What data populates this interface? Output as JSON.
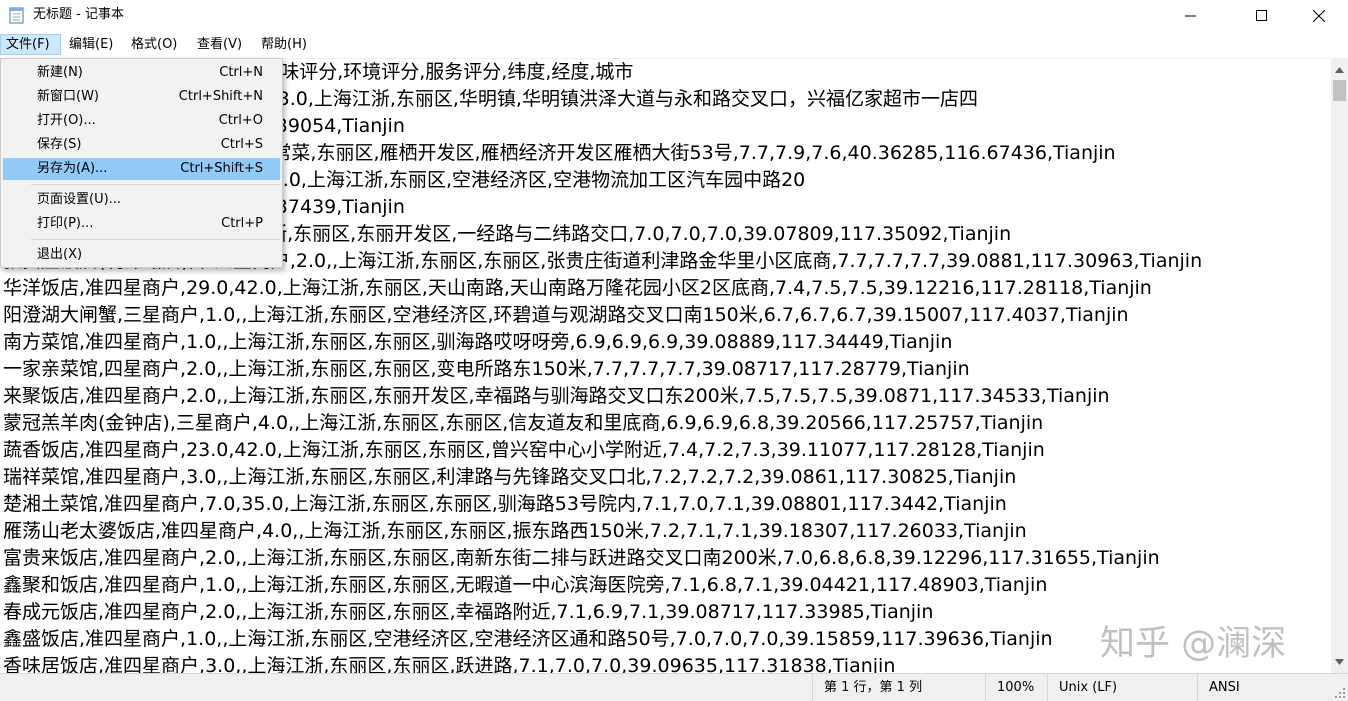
{
  "window": {
    "title": "无标题 - 记事本",
    "controls": {
      "minimize": "—",
      "maximize": "☐",
      "close": "✕"
    }
  },
  "menubar": {
    "items": [
      {
        "label": "文件(F)",
        "active": true
      },
      {
        "label": "编辑(E)"
      },
      {
        "label": "格式(O)"
      },
      {
        "label": "查看(V)"
      },
      {
        "label": "帮助(H)"
      }
    ]
  },
  "file_menu": {
    "items": [
      {
        "label": "新建(N)",
        "shortcut": "Ctrl+N"
      },
      {
        "label": "新窗口(W)",
        "shortcut": "Ctrl+Shift+N"
      },
      {
        "label": "打开(O)...",
        "shortcut": "Ctrl+O"
      },
      {
        "label": "保存(S)",
        "shortcut": "Ctrl+S"
      },
      {
        "label": "另存为(A)...",
        "shortcut": "Ctrl+Shift+S",
        "highlighted": true
      },
      {
        "label": "页面设置(U)...",
        "shortcut": ""
      },
      {
        "label": "打印(P)...",
        "shortcut": "Ctrl+P"
      },
      {
        "label": "退出(X)",
        "shortcut": ""
      }
    ]
  },
  "editor": {
    "lines": [
      "店名,店类型,行政区,商圈,地址,口味评分,环境评分,服务评分,纬度,经度,城市",
      "华明镇饭店,准四星商户,358.0,63.0,上海江浙,东丽区,华明镇,华明镇洪泽大道与永和路交叉口，兴福亿家超市一店四",
      "楼,7.2,7.2,7.2,39.14048,117.39054,Tianjin",
      "雁栖湖饭店,准四星商户,69.0,家常菜,东丽区,雁栖开发区,雁栖经济开发区雁栖大街53号,7.7,7.9,7.6,40.36285,116.67436,Tianjin",
      "空港饭店,准四星商户,109.0,131.0,上海江浙,东丽区,空港经济区,空港物流加工区汽车园中路20",
      "号,7.0,7.0,7.0,39.14582,117.37439,Tianjin",
      "一经路饭店,准四星商户,,上海江浙,东丽区,东丽开发区,一经路与二纬路交口,7.0,7.0,7.0,39.07809,117.35092,Tianjin",
      "张贵庄饭店(利津路店),准四星商户,2.0,,上海江浙,东丽区,东丽区,张贵庄街道利津路金华里小区底商,7.7,7.7,7.7,39.0881,117.30963,Tianjin",
      "华洋饭店,准四星商户,29.0,42.0,上海江浙,东丽区,天山南路,天山南路万隆花园小区2区底商,7.4,7.5,7.5,39.12216,117.28118,Tianjin",
      "阳澄湖大闸蟹,三星商户,1.0,,上海江浙,东丽区,空港经济区,环碧道与观湖路交叉口南150米,6.7,6.7,6.7,39.15007,117.4037,Tianjin",
      "南方菜馆,准四星商户,1.0,,上海江浙,东丽区,东丽区,驯海路哎呀呀旁,6.9,6.9,6.9,39.08889,117.34449,Tianjin",
      "一家亲菜馆,四星商户,2.0,,上海江浙,东丽区,东丽区,变电所路东150米,7.7,7.7,7.7,39.08717,117.28779,Tianjin",
      "来聚饭店,准四星商户,2.0,,上海江浙,东丽区,东丽开发区,幸福路与驯海路交叉口东200米,7.5,7.5,7.5,39.0871,117.34533,Tianjin",
      "蒙冠羔羊肉(金钟店),三星商户,4.0,,上海江浙,东丽区,东丽区,信友道友和里底商,6.9,6.9,6.8,39.20566,117.25757,Tianjin",
      "蔬香饭店,准四星商户,23.0,42.0,上海江浙,东丽区,东丽区,曾兴窑中心小学附近,7.4,7.2,7.3,39.11077,117.28128,Tianjin",
      "瑞祥菜馆,准四星商户,3.0,,上海江浙,东丽区,东丽区,利津路与先锋路交叉口北,7.2,7.2,7.2,39.0861,117.30825,Tianjin",
      "楚湘土菜馆,准四星商户,7.0,35.0,上海江浙,东丽区,东丽区,驯海路53号院内,7.1,7.0,7.1,39.08801,117.3442,Tianjin",
      "雁荡山老太婆饭店,准四星商户,4.0,,上海江浙,东丽区,东丽区,振东路西150米,7.2,7.1,7.1,39.18307,117.26033,Tianjin",
      "富贵来饭店,准四星商户,2.0,,上海江浙,东丽区,东丽区,南新东街二排与跃进路交叉口南200米,7.0,6.8,6.8,39.12296,117.31655,Tianjin",
      "鑫聚和饭店,准四星商户,1.0,,上海江浙,东丽区,东丽区,无暇道一中心滨海医院旁,7.1,6.8,7.1,39.04421,117.48903,Tianjin",
      "春成元饭店,准四星商户,2.0,,上海江浙,东丽区,东丽区,幸福路附近,7.1,6.9,7.1,39.08717,117.33985,Tianjin",
      "鑫盛饭店,准四星商户,1.0,,上海江浙,东丽区,空港经济区,空港经济区通和路50号,7.0,7.0,7.0,39.15859,117.39636,Tianjin",
      "香味居饭店,准四星商户,3.0,,上海江浙,东丽区,东丽区,跃进路,7.1,7.0,7.0,39.09635,117.31838,Tianjin"
    ]
  },
  "statusbar": {
    "position": "第 1 行，第 1 列",
    "zoom": "100%",
    "line_ending": "Unix (LF)",
    "encoding": "ANSI"
  },
  "watermark": "知乎 @澜深",
  "colors": {
    "menu_active_bg": "#cce8ff",
    "menu_item_highlight": "#91c9f7",
    "dropdown_bg": "#f2f2f2",
    "statusbar_bg": "#f0f0f0",
    "scrollbar_bg": "#f0f0f0"
  }
}
